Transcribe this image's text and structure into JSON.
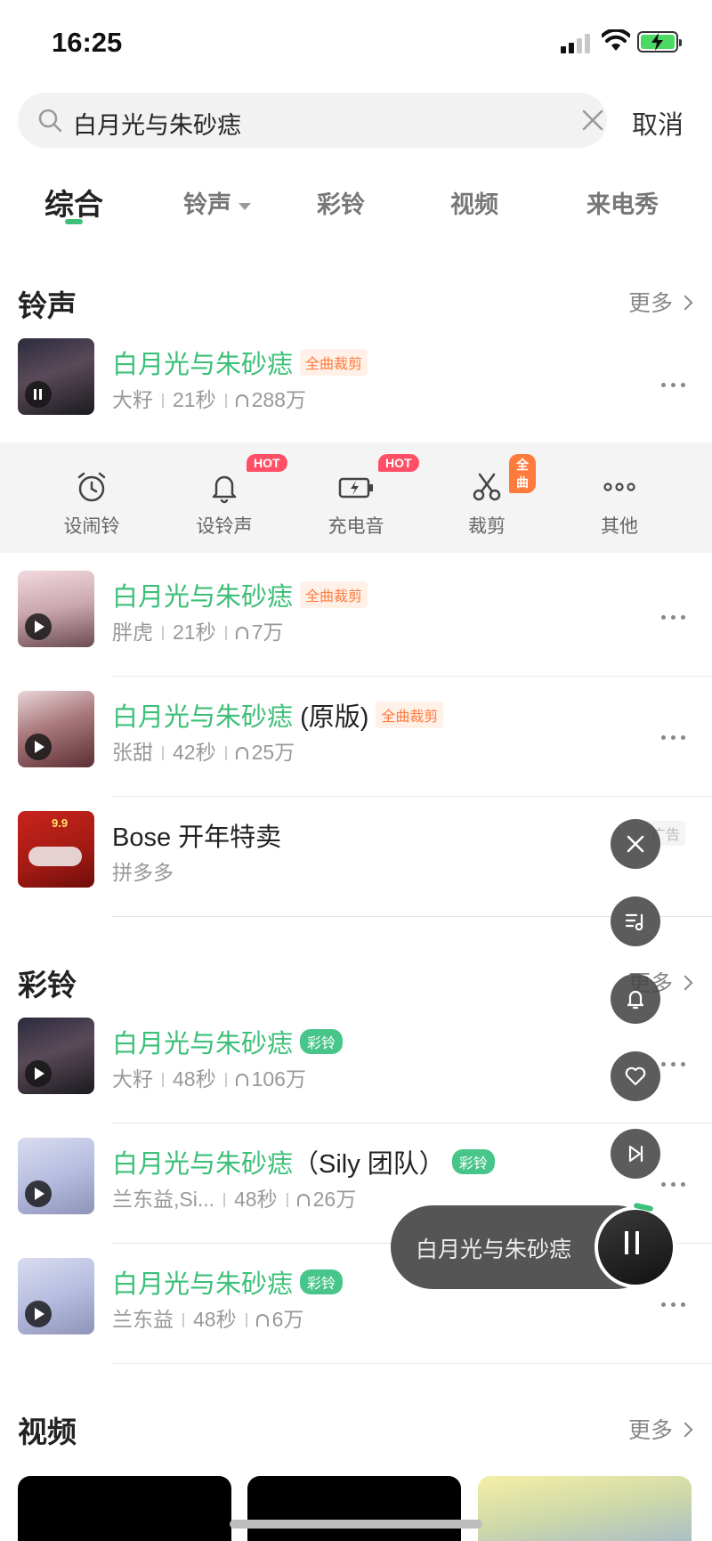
{
  "status_bar": {
    "time": "16:25"
  },
  "search": {
    "query": "白月光与朱砂痣",
    "cancel_label": "取消"
  },
  "tabs": [
    {
      "label": "综合",
      "active": true
    },
    {
      "label": "铃声",
      "has_dropdown": true
    },
    {
      "label": "彩铃"
    },
    {
      "label": "视频"
    },
    {
      "label": "来电秀"
    }
  ],
  "ringtones": {
    "title": "铃声",
    "more_label": "更多",
    "items": [
      {
        "title": "白月光与朱砂痣",
        "tag": "全曲裁剪",
        "artist": "大籽",
        "duration": "21秒",
        "plays": "288万",
        "playing": true
      },
      {
        "title": "白月光与朱砂痣",
        "tag": "全曲裁剪",
        "artist": "胖虎",
        "duration": "21秒",
        "plays": "7万"
      },
      {
        "title": "白月光与朱砂痣",
        "title_suffix": "(原版)",
        "tag": "全曲裁剪",
        "artist": "张甜",
        "duration": "42秒",
        "plays": "25万"
      }
    ]
  },
  "actions": [
    {
      "label": "设闹铃",
      "icon": "alarm-clock-icon"
    },
    {
      "label": "设铃声",
      "icon": "bell-icon",
      "badge": "HOT"
    },
    {
      "label": "充电音",
      "icon": "charging-icon",
      "badge": "HOT"
    },
    {
      "label": "裁剪",
      "icon": "scissors-icon",
      "badge": "全曲"
    },
    {
      "label": "其他",
      "icon": "more-icon"
    }
  ],
  "ad": {
    "title": "Bose 开年特卖",
    "source": "拼多多",
    "ad_label": "广告",
    "thumb_text": "9.9"
  },
  "color_rings": {
    "title": "彩铃",
    "more_label": "更多",
    "items": [
      {
        "title": "白月光与朱砂痣",
        "tag": "彩铃",
        "artist": "大籽",
        "duration": "48秒",
        "plays": "106万"
      },
      {
        "title": "白月光与朱砂痣",
        "title_suffix": "（Sily 团队）",
        "tag": "彩铃",
        "artist": "兰东益,Si...",
        "duration": "48秒",
        "plays": "26万"
      },
      {
        "title": "白月光与朱砂痣",
        "tag": "彩铃",
        "artist": "兰东益",
        "duration": "48秒",
        "plays": "6万"
      }
    ]
  },
  "videos": {
    "title": "视频",
    "more_label": "更多"
  },
  "now_playing": {
    "title": "白月光与朱砂痣"
  },
  "colors": {
    "accent": "#3cbf78",
    "tag_orange": "#ff7a3d",
    "hot_badge": "#ff4f67"
  }
}
